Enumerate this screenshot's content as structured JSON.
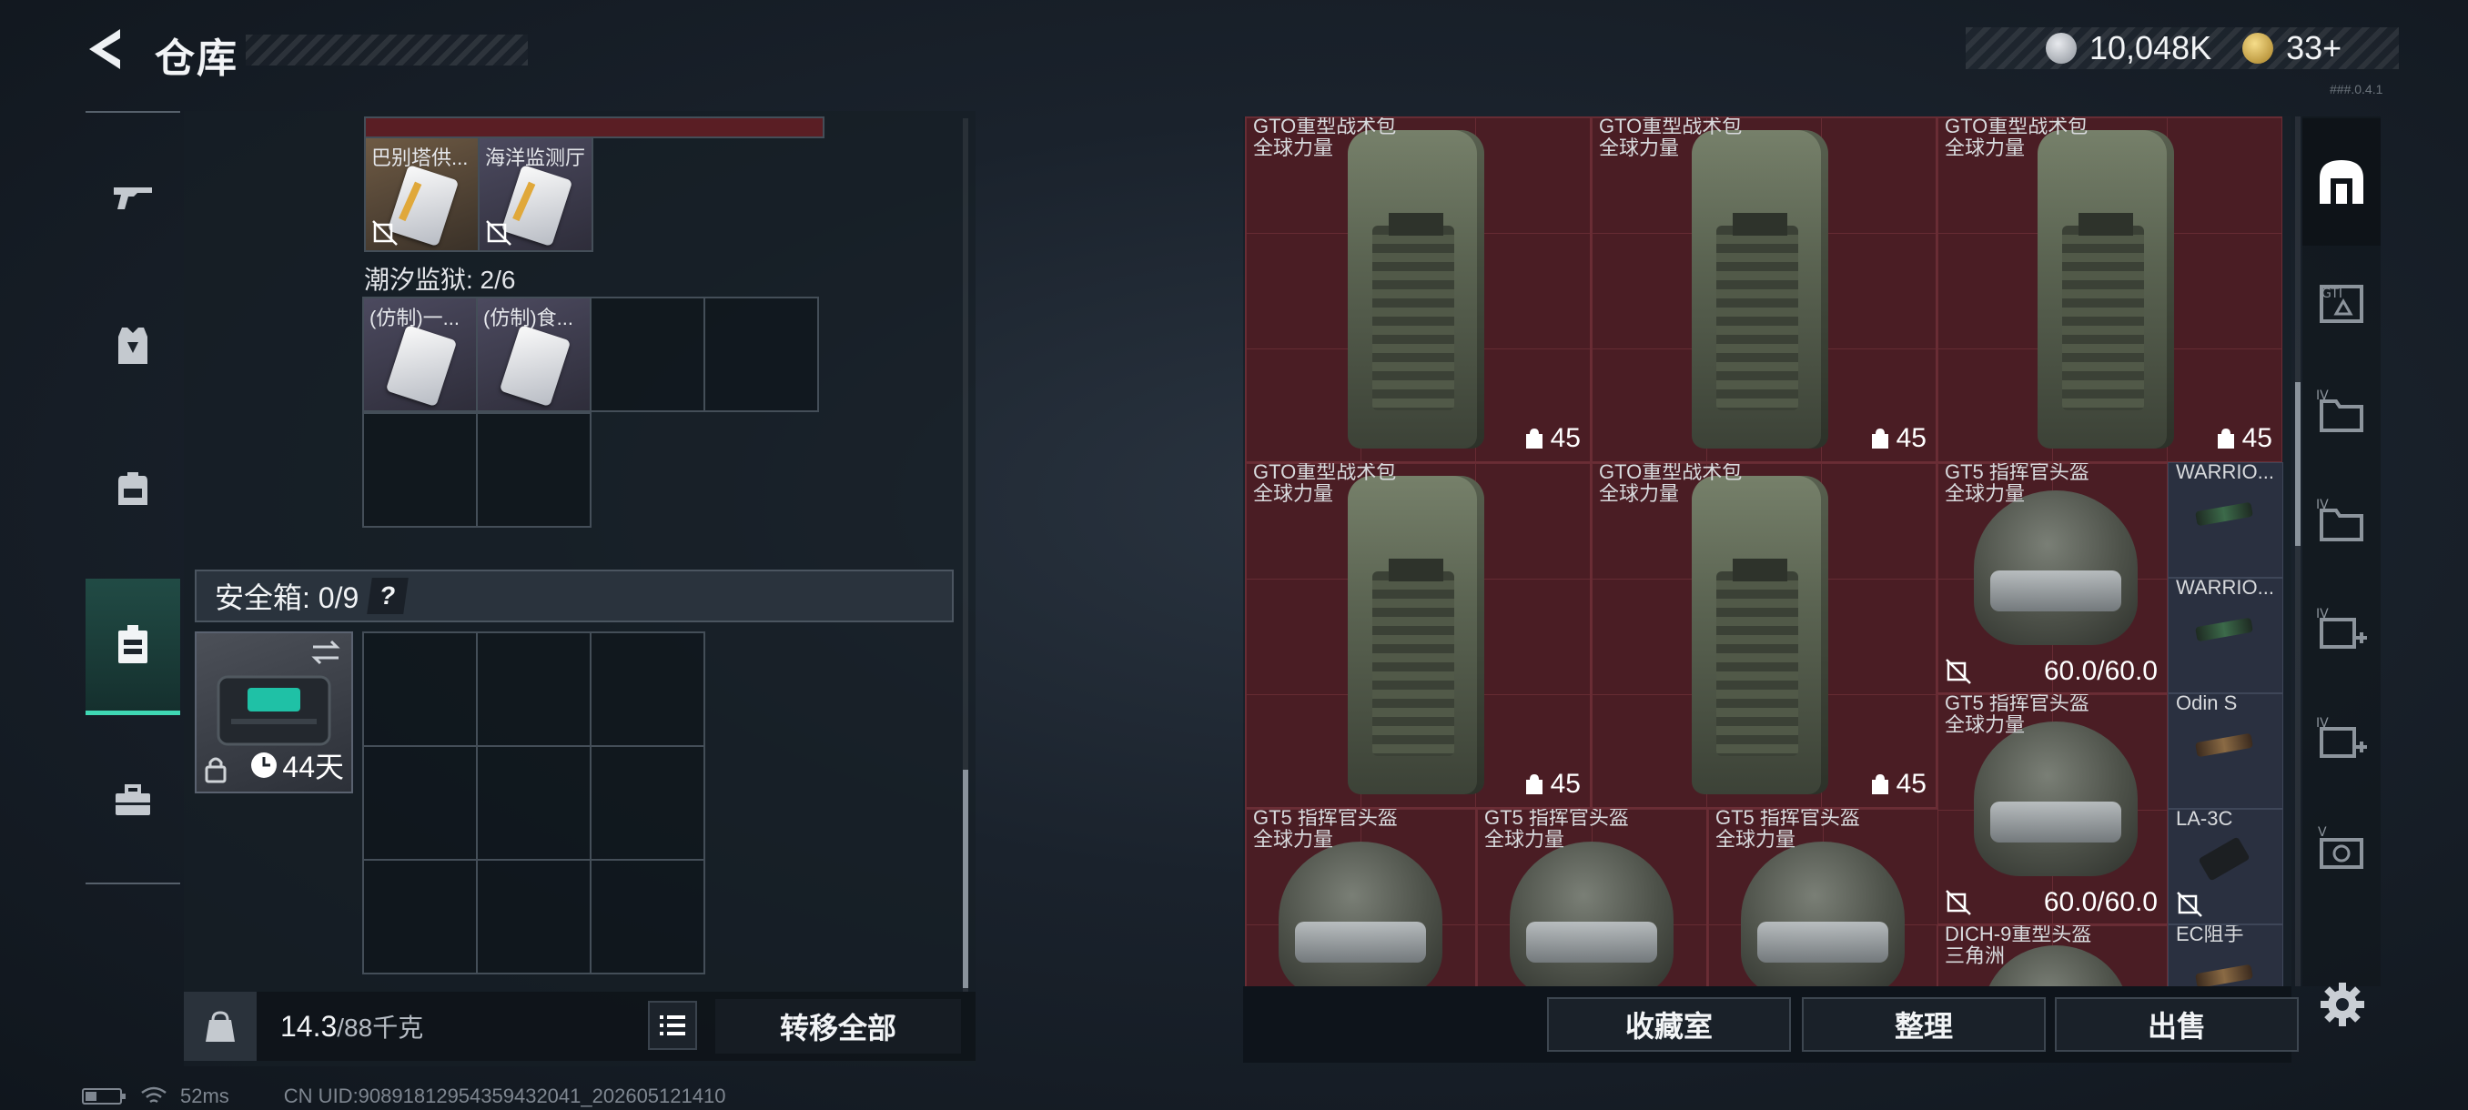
{
  "header": {
    "title": "仓库",
    "currency_silver": "10,048K",
    "currency_gold": "33+",
    "version": "###.0.4.1"
  },
  "left_tabs": [
    "gun-icon",
    "armor-icon",
    "backpack-icon",
    "safebox-icon",
    "toolbox-icon"
  ],
  "backpack": {
    "top_items": [
      {
        "label": "巴别塔供...",
        "rarity": "orange"
      },
      {
        "label": "海洋监测厅",
        "rarity": "purple"
      }
    ],
    "tide_prison_label": "潮汐监狱: 2/6",
    "tide_items": [
      {
        "label": "(仿制)一...",
        "rarity": "purple"
      },
      {
        "label": "(仿制)食...",
        "rarity": "purple"
      }
    ],
    "safe_box_label": "安全箱: 0/9",
    "safe_help": "?",
    "safe_box_time": "44天",
    "weight_value": "14.3",
    "weight_cap": "/88千克",
    "transfer_all": "转移全部"
  },
  "storage": {
    "items": [
      {
        "name": "GTO重型战术包",
        "sub": "全球力量",
        "capacity": "45"
      },
      {
        "name": "GTO重型战术包",
        "sub": "全球力量",
        "capacity": "45"
      },
      {
        "name": "GTO重型战术包",
        "sub": "全球力量",
        "capacity": "45"
      },
      {
        "name": "GTO重型战术包",
        "sub": "全球力量",
        "capacity": "45"
      },
      {
        "name": "GTO重型战术包",
        "sub": "全球力量",
        "capacity": "45"
      },
      {
        "name": "GT5 指挥官头盔",
        "sub": "全球力量",
        "durability": "60.0/60.0"
      },
      {
        "name": "GT5 指挥官头盔",
        "sub": "全球力量",
        "durability": "60.0/60.0"
      },
      {
        "name": "GT5 指挥官头盔",
        "sub": "全球力量"
      },
      {
        "name": "GT5 指挥官头盔",
        "sub": "全球力量"
      },
      {
        "name": "GT5 指挥官头盔",
        "sub": "全球力量"
      },
      {
        "name": "DICH-9重型头盔",
        "sub": "三角洲"
      }
    ],
    "attachments": [
      "WARRIO...",
      "WARRIO...",
      "Odin S",
      "LA-3C",
      "EC阻手"
    ],
    "buttons": {
      "collection": "收藏室",
      "organize": "整理",
      "sell": "出售"
    }
  },
  "right_tabs": [
    "storage-icon",
    "gti-tab-icon",
    "folder-iv-icon",
    "folder-iv-icon-2",
    "add-iv-icon",
    "add-iv-icon-2",
    "camera-v-icon"
  ],
  "status": {
    "ping": "52ms",
    "uid": "CN UID:9089181295435943​2041_202605121410"
  },
  "colors": {
    "accent": "#3fd7b3",
    "item_red": "#4a1d24"
  }
}
